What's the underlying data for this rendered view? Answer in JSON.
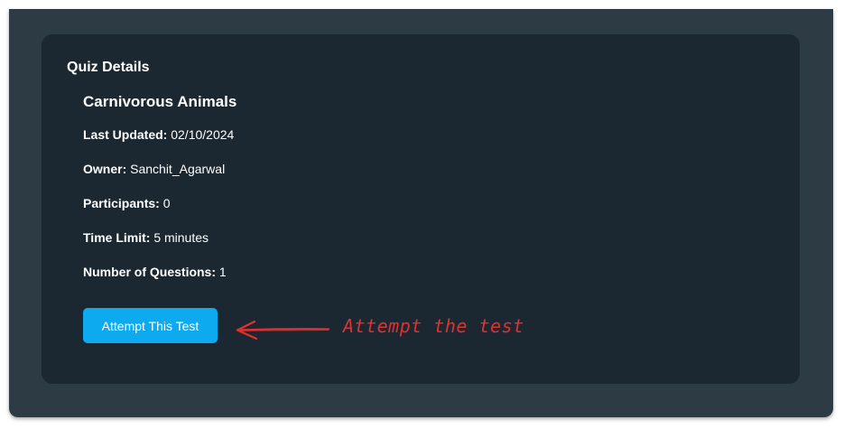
{
  "quiz": {
    "section_title": "Quiz Details",
    "name": "Carnivorous Animals",
    "details": [
      {
        "label": "Last Updated:",
        "value": "02/10/2024"
      },
      {
        "label": "Owner:",
        "value": "Sanchit_Agarwal"
      },
      {
        "label": "Participants:",
        "value": "0"
      },
      {
        "label": "Time Limit:",
        "value": "5 minutes"
      },
      {
        "label": "Number of Questions:",
        "value": "1"
      }
    ],
    "attempt_button_label": "Attempt This Test"
  },
  "annotation": {
    "text": "Attempt the test",
    "color": "#e03131",
    "icon": "arrow-left-icon"
  },
  "colors": {
    "outer_background": "#2d3b45",
    "card_background": "#1b2831",
    "button_accent": "#0eaaf0"
  }
}
